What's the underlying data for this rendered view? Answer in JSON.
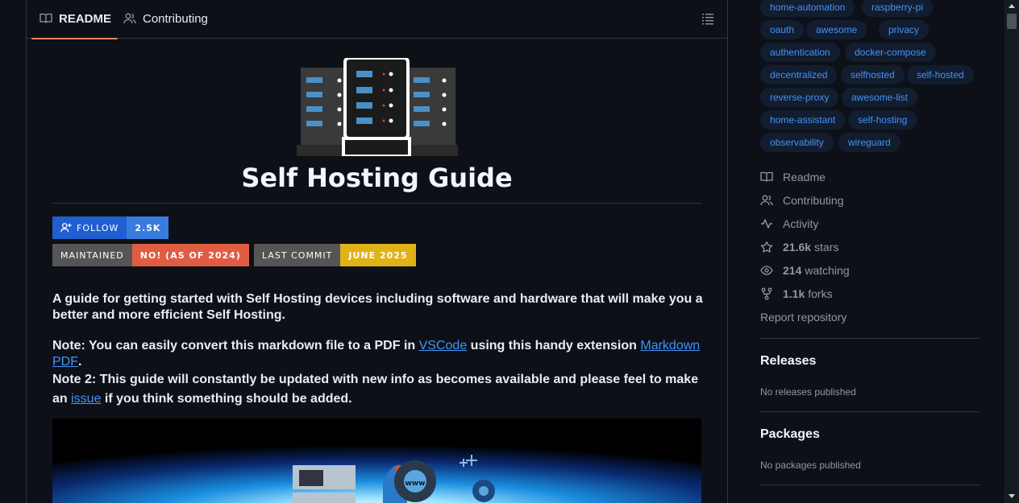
{
  "tabs": {
    "readme": "README",
    "contributing": "Contributing"
  },
  "readme": {
    "title": "Self Hosting Guide",
    "badges": {
      "follow_label": "FOLLOW",
      "follow_count": "2.5K",
      "maintained_label": "MAINTAINED",
      "maintained_value": "NO! (AS OF 2024)",
      "commit_label": "LAST COMMIT",
      "commit_value": "JUNE 2025"
    },
    "p1": "A guide for getting started with Self Hosting devices including software and hardware that will make you a better and more efficient Self Hosting.",
    "p2_before": "Note: You can easily convert this markdown file to a PDF in ",
    "p2_link1": "VSCode",
    "p2_mid": " using this handy extension ",
    "p2_link2": "Markdown PDF",
    "p2_after": ".",
    "p3_before": "Note 2: This guide will constantly be updated with new info as becomes available and please feel to make an ",
    "p3_link": "issue",
    "p3_after": " if you think something should be added.",
    "hero_text": "www"
  },
  "topics": [
    "home-automation",
    "raspberry-pi",
    "oauth",
    "awesome",
    "privacy",
    "authentication",
    "docker-compose",
    "decentralized",
    "selfhosted",
    "self-hosted",
    "reverse-proxy",
    "awesome-list",
    "home-assistant",
    "self-hosting",
    "observability",
    "wireguard"
  ],
  "sidebar": {
    "readme": "Readme",
    "contributing": "Contributing",
    "activity": "Activity",
    "stars_count": "21.6k",
    "stars_label": "stars",
    "watching_count": "214",
    "watching_label": "watching",
    "forks_count": "1.1k",
    "forks_label": "forks",
    "report": "Report repository",
    "releases_title": "Releases",
    "releases_text": "No releases published",
    "packages_title": "Packages",
    "packages_text": "No packages published"
  },
  "colors": {
    "background": "#0d1117",
    "link": "#4493f8",
    "tab_underline": "#f78166"
  }
}
